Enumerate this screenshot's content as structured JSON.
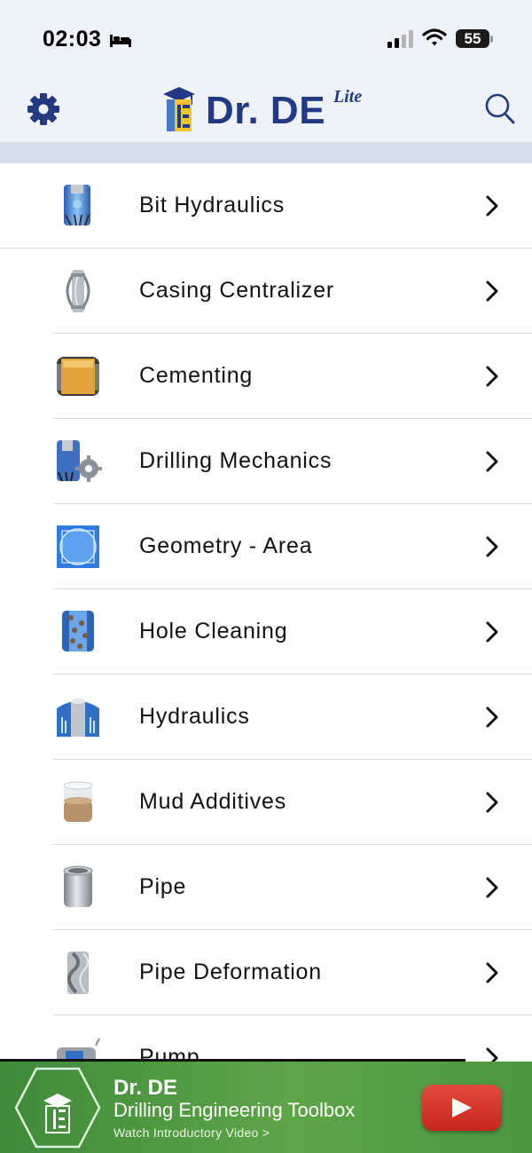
{
  "status_bar": {
    "time": "02:03",
    "battery": "55",
    "icons": [
      "bed-icon",
      "signal-icon",
      "wifi-icon",
      "battery-icon"
    ]
  },
  "header": {
    "brand": "Dr. DE",
    "edition": "Lite",
    "left_icon": "gear-icon",
    "right_icon": "search-icon"
  },
  "menu": {
    "items": [
      {
        "label": "Bit Hydraulics",
        "icon": "bit-hydraulics-icon"
      },
      {
        "label": "Casing Centralizer",
        "icon": "casing-centralizer-icon"
      },
      {
        "label": "Cementing",
        "icon": "cementing-icon"
      },
      {
        "label": "Drilling Mechanics",
        "icon": "drilling-mechanics-icon"
      },
      {
        "label": "Geometry - Area",
        "icon": "geometry-area-icon"
      },
      {
        "label": "Hole Cleaning",
        "icon": "hole-cleaning-icon"
      },
      {
        "label": "Hydraulics",
        "icon": "hydraulics-icon"
      },
      {
        "label": "Mud Additives",
        "icon": "mud-additives-icon"
      },
      {
        "label": "Pipe",
        "icon": "pipe-icon"
      },
      {
        "label": "Pipe Deformation",
        "icon": "pipe-deformation-icon"
      },
      {
        "label": "Pump",
        "icon": "pump-icon"
      }
    ],
    "chevron_icon": "chevron-right-icon"
  },
  "banner": {
    "title": "Dr. DE",
    "subtitle": "Drilling Engineering Toolbox",
    "cta": "Watch Introductory Video >",
    "button_icon": "youtube-play-icon"
  },
  "colors": {
    "brand_blue": "#223a86",
    "header_bg": "#eef3f9",
    "band": "#d6e1ec",
    "banner_green": "#5ea548",
    "youtube_red": "#d33426"
  }
}
